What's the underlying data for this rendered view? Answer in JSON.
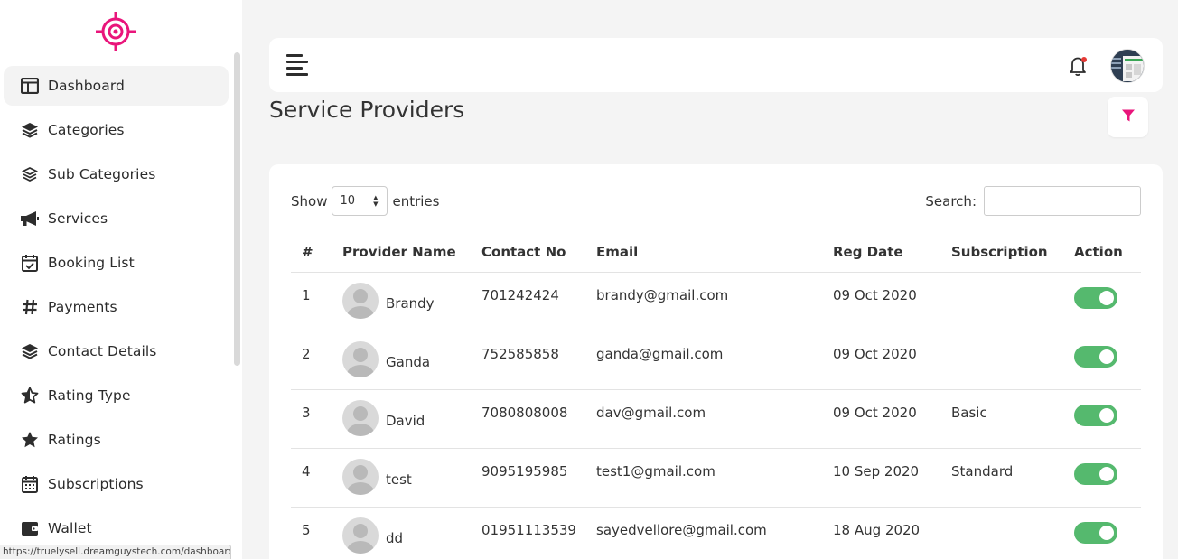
{
  "brand_color": "#e9157b",
  "sidebar": {
    "items": [
      {
        "label": "Dashboard",
        "icon": "layout-columns-icon",
        "active": true
      },
      {
        "label": "Categories",
        "icon": "layers-icon"
      },
      {
        "label": "Sub Categories",
        "icon": "layers-outline-icon"
      },
      {
        "label": "Services",
        "icon": "megaphone-icon"
      },
      {
        "label": "Booking List",
        "icon": "calendar-check-icon"
      },
      {
        "label": "Payments",
        "icon": "hash-icon"
      },
      {
        "label": "Contact Details",
        "icon": "layers-icon"
      },
      {
        "label": "Rating Type",
        "icon": "star-half-icon"
      },
      {
        "label": "Ratings",
        "icon": "star-icon"
      },
      {
        "label": "Subscriptions",
        "icon": "calendar-grid-icon"
      },
      {
        "label": "Wallet",
        "icon": "wallet-icon"
      }
    ]
  },
  "status_bar": {
    "url": "https://truelysell.dreamguystech.com/dashboard"
  },
  "page": {
    "title": "Service Providers"
  },
  "table_controls": {
    "show_label": "Show",
    "entries_value": "10",
    "entries_label": "entries",
    "search_label": "Search:"
  },
  "table": {
    "columns": [
      "#",
      "Provider Name",
      "Contact No",
      "Email",
      "Reg Date",
      "Subscription",
      "Action"
    ],
    "rows": [
      {
        "num": "1",
        "name": "Brandy",
        "contact": "701242424",
        "email": "brandy@gmail.com",
        "reg_date": "09 Oct 2020",
        "subscription": "",
        "active": true
      },
      {
        "num": "2",
        "name": "Ganda",
        "contact": "752585858",
        "email": "ganda@gmail.com",
        "reg_date": "09 Oct 2020",
        "subscription": "",
        "active": true
      },
      {
        "num": "3",
        "name": "David",
        "contact": "7080808008",
        "email": "dav@gmail.com",
        "reg_date": "09 Oct 2020",
        "subscription": "Basic",
        "active": true
      },
      {
        "num": "4",
        "name": "test",
        "contact": "9095195985",
        "email": "test1@gmail.com",
        "reg_date": "10 Sep 2020",
        "subscription": "Standard",
        "active": true
      },
      {
        "num": "5",
        "name": "dd",
        "contact": "01951113539",
        "email": "sayedvellore@gmail.com",
        "reg_date": "18 Aug 2020",
        "subscription": "",
        "active": true
      }
    ]
  }
}
